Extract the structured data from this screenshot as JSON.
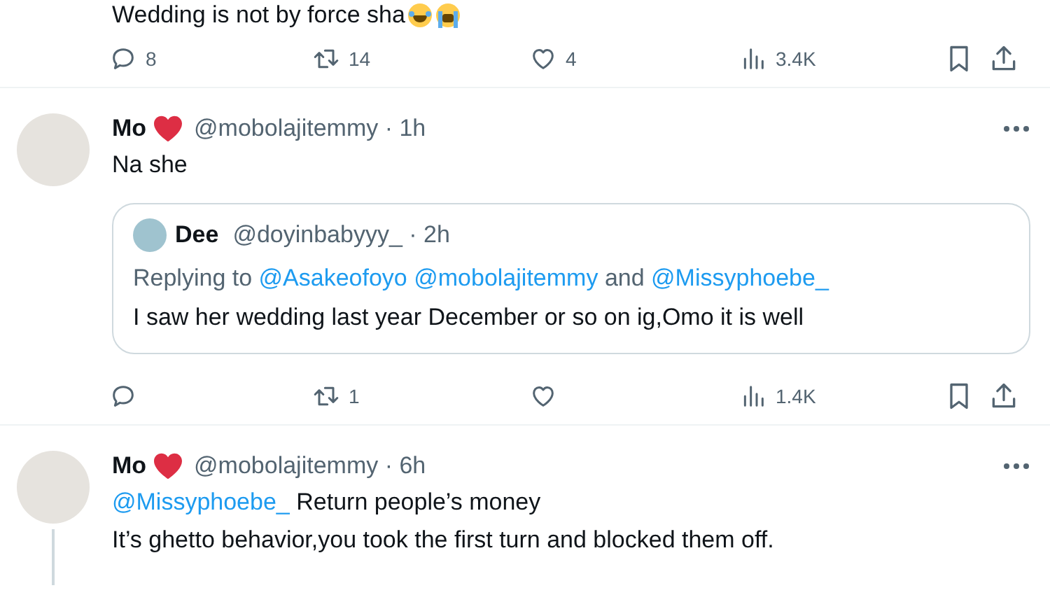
{
  "top_tweet": {
    "text": "Wedding is not by force sha",
    "actions": {
      "replies": "8",
      "reposts": "14",
      "likes": "4",
      "views": "3.4K"
    }
  },
  "tweets": [
    {
      "name": "Mo",
      "meta": "@mobolajitemmy · 1h",
      "body": [
        {
          "parts": [
            {
              "kind": "plain",
              "text": "Na she"
            }
          ]
        }
      ],
      "quote": {
        "name": "Dee",
        "meta": "@doyinbabyyy_ · 2h",
        "replying": [
          {
            "kind": "plain",
            "text": "Replying to"
          },
          {
            "kind": "mention",
            "text": "@Asakeofoyo"
          },
          {
            "kind": "mention",
            "text": "@mobolajitemmy"
          },
          {
            "kind": "plain",
            "text": "and"
          },
          {
            "kind": "mention",
            "text": "@Missyphoebe_"
          }
        ],
        "text": "I saw her wedding last year December or so on ig,Omo it is well"
      },
      "actions": {
        "reposts": "1",
        "views": "1.4K"
      }
    },
    {
      "name": "Mo",
      "meta": "@mobolajitemmy · 6h",
      "body": [
        {
          "parts": [
            {
              "kind": "mention",
              "text": "@Missyphoebe_"
            },
            {
              "kind": "plain",
              "text": "Return people’s money"
            }
          ]
        },
        {
          "parts": [
            {
              "kind": "plain",
              "text": "It’s ghetto behavior,you took the first turn and blocked them off."
            }
          ]
        }
      ],
      "thread_line": true
    }
  ]
}
